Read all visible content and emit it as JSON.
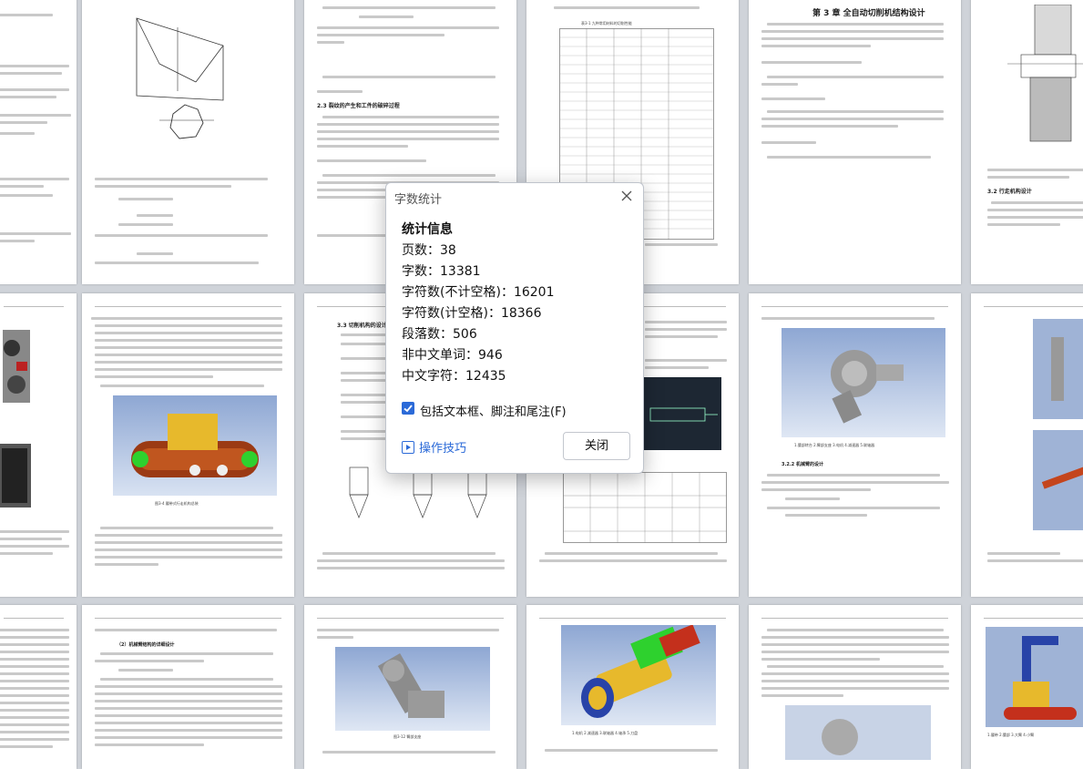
{
  "pages": {
    "row1": [
      {
        "page_num": "",
        "heading": ""
      },
      {
        "page_num": "",
        "heading": ""
      },
      {
        "page_num": "",
        "heading": "2.3 裂纹的产生和工件的破碎过程"
      },
      {
        "page_num": "",
        "heading": "表3-1 九种常用材料的切削性能"
      },
      {
        "page_num": "",
        "heading": "第 3 章 全自动切削机结构设计"
      },
      {
        "page_num": "",
        "heading": "3.2 行走机构设计"
      }
    ],
    "row2": [
      {
        "page_num": "",
        "heading": ""
      },
      {
        "page_num": "",
        "heading": ""
      },
      {
        "page_num": "",
        "heading": "3.3 切削机构的设计"
      },
      {
        "page_num": "",
        "heading": ""
      },
      {
        "page_num": "",
        "heading": "3.2.2 机械臂的设计"
      },
      {
        "page_num": "",
        "heading": ""
      }
    ],
    "row3": [
      {
        "page_num": "",
        "heading": ""
      },
      {
        "page_num": "",
        "heading": "（2）机械臂结构的详细设计"
      },
      {
        "page_num": "",
        "heading": "图3-12 臂部支座"
      },
      {
        "page_num": "",
        "heading": ""
      },
      {
        "page_num": "",
        "heading": ""
      },
      {
        "page_num": "",
        "heading": ""
      }
    ]
  },
  "dialog": {
    "title": "字数统计",
    "heading": "统计信息",
    "stats": [
      {
        "label": "页数",
        "value": "38"
      },
      {
        "label": "字数",
        "value": "13381"
      },
      {
        "label": "字符数(不计空格)",
        "value": "16201"
      },
      {
        "label": "字符数(计空格)",
        "value": "18366"
      },
      {
        "label": "段落数",
        "value": "506"
      },
      {
        "label": "非中文单词",
        "value": "946"
      },
      {
        "label": "中文字符",
        "value": "12435"
      }
    ],
    "checkbox_label": "包括文本框、脚注和尾注(F)",
    "checkbox_checked": true,
    "tips_label": "操作技巧",
    "close_button": "关闭"
  },
  "colors": {
    "accent": "#2b6ad8",
    "render_blue": "#5f7fb4",
    "machine_brown": "#9b3a14",
    "machine_yellow": "#e7b92c",
    "machine_green": "#2ed12e"
  },
  "icons": [
    "close-icon",
    "checkbox-checked-icon",
    "tips-icon"
  ]
}
